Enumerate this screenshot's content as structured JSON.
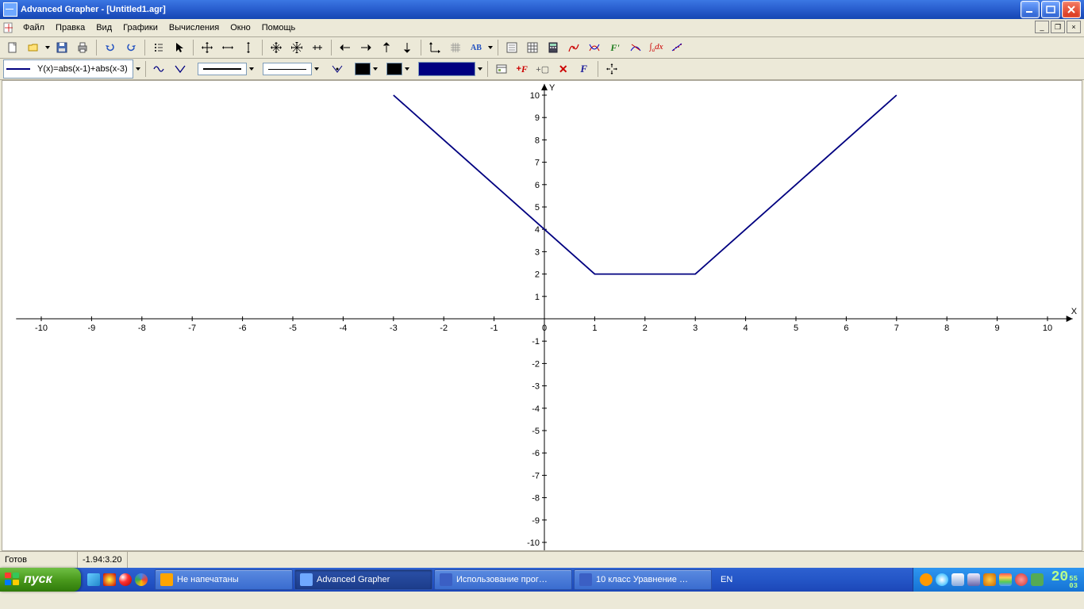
{
  "titlebar": {
    "text": "Advanced Grapher - [Untitled1.agr]"
  },
  "menu": {
    "items": [
      "Файл",
      "Правка",
      "Вид",
      "Графики",
      "Вычисления",
      "Окно",
      "Помощь"
    ]
  },
  "toolbar_row2": {
    "function_label": "Y(x)=abs(x-1)+abs(x-3)"
  },
  "statusbar": {
    "ready": "Готов",
    "coords": "-1.94:3.20"
  },
  "taskbar": {
    "start": "пуск",
    "buttons": [
      {
        "label": "Не напечатаны",
        "color": "#ffa500"
      },
      {
        "label": "Advanced Grapher",
        "color": "#6fa8ff",
        "active": true
      },
      {
        "label": "Использование прог…",
        "color": "#3b5fc4"
      },
      {
        "label": "10 класс Уравнение …",
        "color": "#3b5fc4"
      }
    ],
    "lang": "EN",
    "clock": {
      "time": "20",
      "sec_top": "55",
      "sec_bot": "03"
    }
  },
  "chart_data": {
    "type": "line",
    "title": "",
    "xlabel": "X",
    "ylabel": "Y",
    "xlim": [
      -10.5,
      10.5
    ],
    "ylim": [
      -10.5,
      10.5
    ],
    "x_ticks": [
      -10,
      -9,
      -8,
      -7,
      -6,
      -5,
      -4,
      -3,
      -2,
      -1,
      0,
      1,
      2,
      3,
      4,
      5,
      6,
      7,
      8,
      9,
      10
    ],
    "y_ticks": [
      -10,
      -9,
      -8,
      -7,
      -6,
      -5,
      -4,
      -3,
      -2,
      -1,
      1,
      2,
      3,
      4,
      5,
      6,
      7,
      8,
      9,
      10
    ],
    "series": [
      {
        "name": "Y(x)=abs(x-1)+abs(x-3)",
        "color": "#000080",
        "x": [
          -3,
          -2,
          -1,
          0,
          1,
          2,
          3,
          4,
          5,
          6,
          7
        ],
        "y": [
          10,
          8,
          6,
          4,
          2,
          2,
          2,
          4,
          6,
          8,
          10
        ]
      }
    ]
  }
}
